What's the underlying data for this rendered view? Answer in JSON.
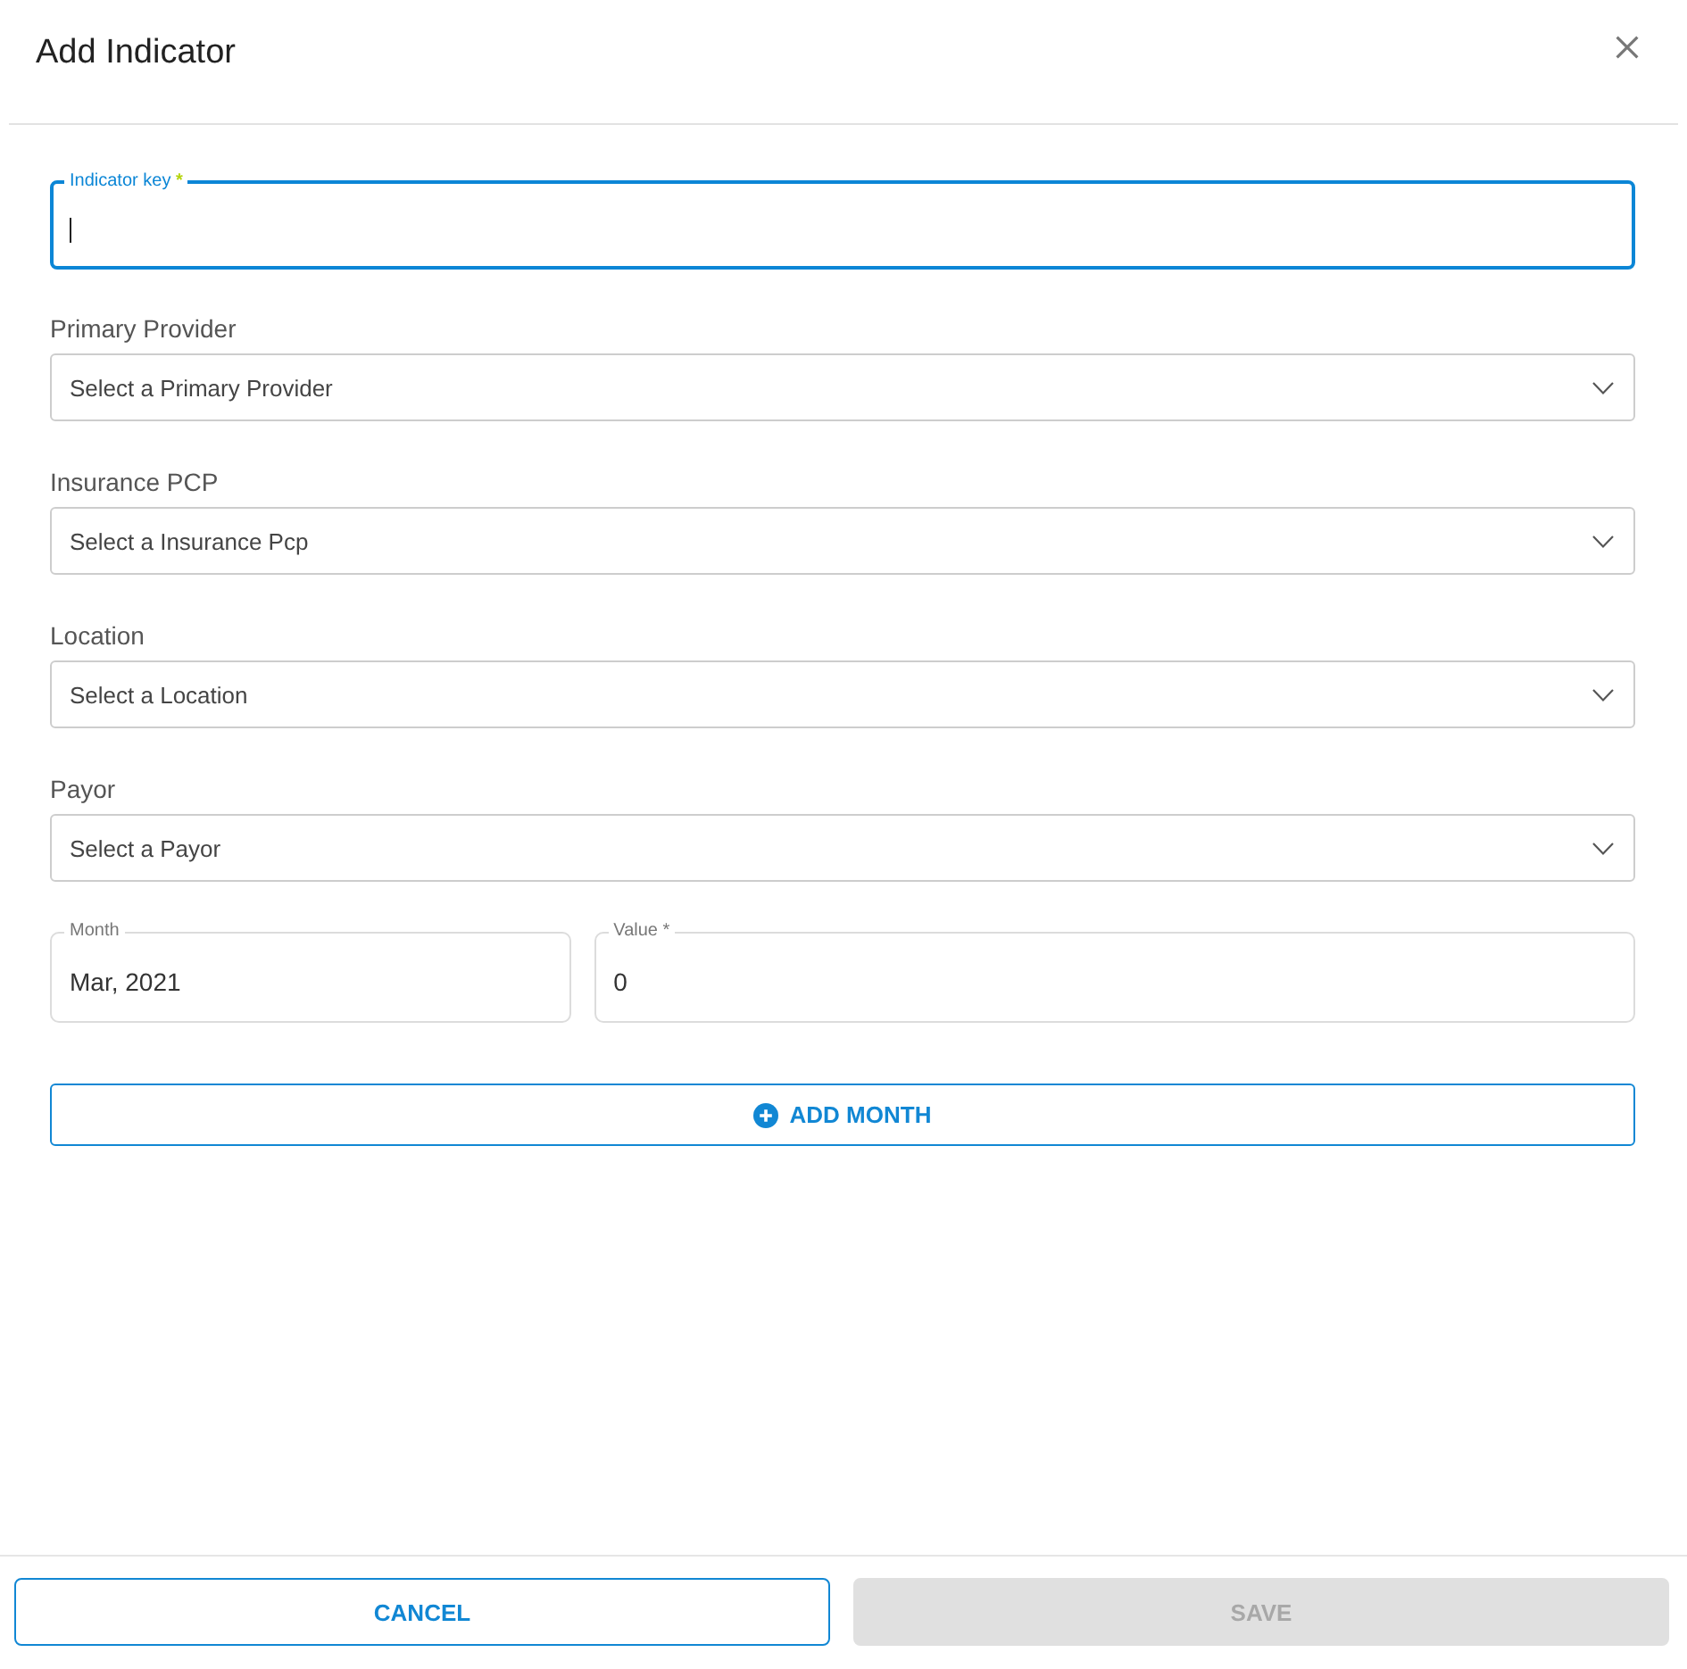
{
  "dialog": {
    "title": "Add Indicator"
  },
  "indicator_key": {
    "label": "Indicator key",
    "required_mark": "*",
    "focused": true
  },
  "selects": [
    {
      "label": "Primary Provider",
      "placeholder": "Select a Primary Provider"
    },
    {
      "label": "Insurance PCP",
      "placeholder": "Select a Insurance Pcp"
    },
    {
      "label": "Location",
      "placeholder": "Select a Location"
    },
    {
      "label": "Payor",
      "placeholder": "Select a Payor"
    }
  ],
  "month_row": [
    {
      "label": "Month",
      "value": "Mar, 2021"
    },
    {
      "label": "Value",
      "required_mark": "*",
      "value": "0"
    }
  ],
  "add_month_button": {
    "label": "ADD MONTH"
  },
  "footer": {
    "buttons": [
      {
        "label": "CANCEL",
        "kind": "outlined",
        "disabled": false
      },
      {
        "label": "SAVE",
        "kind": "filled",
        "disabled": true
      }
    ]
  }
}
